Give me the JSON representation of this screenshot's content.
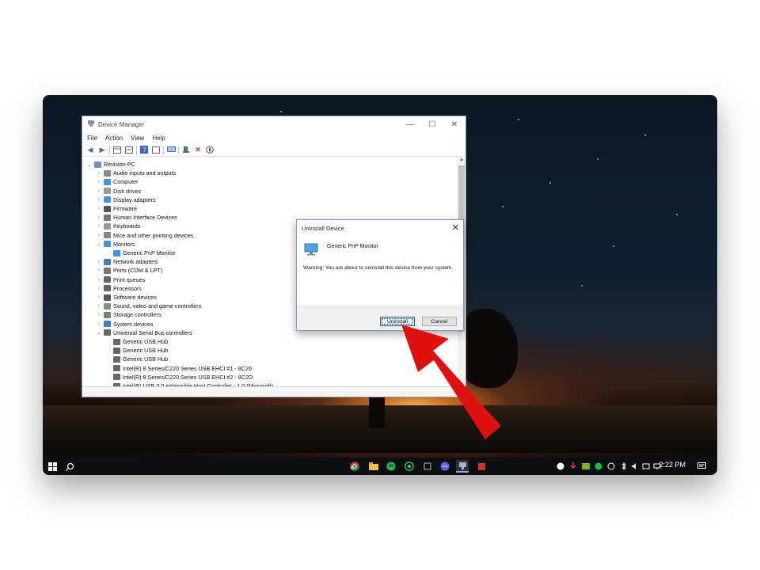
{
  "window": {
    "title": "Device Manager",
    "menu": [
      "File",
      "Action",
      "View",
      "Help"
    ],
    "controls": {
      "minimize": "—",
      "maximize": "☐",
      "close": "✕"
    }
  },
  "tree": [
    {
      "label": "Revision-PC",
      "level": 0,
      "expanded": true,
      "icon": "computer-icon"
    },
    {
      "label": "Audio inputs and outputs",
      "level": 1,
      "icon": "speaker-icon"
    },
    {
      "label": "Computer",
      "level": 1,
      "icon": "monitor-icon"
    },
    {
      "label": "Disk drives",
      "level": 1,
      "icon": "disk-icon"
    },
    {
      "label": "Display adapters",
      "level": 1,
      "icon": "display-icon"
    },
    {
      "label": "Firmware",
      "level": 1,
      "icon": "chip-icon"
    },
    {
      "label": "Human Interface Devices",
      "level": 1,
      "icon": "hid-icon"
    },
    {
      "label": "Keyboards",
      "level": 1,
      "icon": "keyboard-icon"
    },
    {
      "label": "Mice and other pointing devices",
      "level": 1,
      "icon": "mouse-icon"
    },
    {
      "label": "Monitors",
      "level": 1,
      "expanded": true,
      "icon": "monitor-icon"
    },
    {
      "label": "Generic PnP Monitor",
      "level": 2,
      "icon": "monitor-icon"
    },
    {
      "label": "Network adapters",
      "level": 1,
      "icon": "network-icon"
    },
    {
      "label": "Ports (COM & LPT)",
      "level": 1,
      "icon": "port-icon"
    },
    {
      "label": "Print queues",
      "level": 1,
      "icon": "printer-icon"
    },
    {
      "label": "Processors",
      "level": 1,
      "icon": "cpu-icon"
    },
    {
      "label": "Software devices",
      "level": 1,
      "icon": "software-icon"
    },
    {
      "label": "Sound, video and game controllers",
      "level": 1,
      "icon": "speaker-icon"
    },
    {
      "label": "Storage controllers",
      "level": 1,
      "icon": "storage-icon"
    },
    {
      "label": "System devices",
      "level": 1,
      "icon": "folder-icon"
    },
    {
      "label": "Universal Serial Bus controllers",
      "level": 1,
      "expanded": true,
      "icon": "usb-icon"
    },
    {
      "label": "Generic USB Hub",
      "level": 2,
      "icon": "usb-icon"
    },
    {
      "label": "Generic USB Hub",
      "level": 2,
      "icon": "usb-icon"
    },
    {
      "label": "Generic USB Hub",
      "level": 2,
      "icon": "usb-icon"
    },
    {
      "label": "Intel(R) 8 Series/C220 Series USB EHCI #1 - 8C26",
      "level": 2,
      "icon": "usb-icon"
    },
    {
      "label": "Intel(R) 8 Series/C220 Series USB EHCI #2 - 8C2D",
      "level": 2,
      "icon": "usb-icon"
    },
    {
      "label": "Intel(R) USB 3.0 eXtensible Host Controller - 1.0 (Microsoft)",
      "level": 2,
      "icon": "usb-icon"
    }
  ],
  "dialog": {
    "title": "Uninstall Device",
    "device": "Generic PnP Monitor",
    "warning": "Warning: You are about to uninstall this device from your system.",
    "uninstall_label": "Uninstall",
    "cancel_label": "Cancel"
  },
  "taskbar": {
    "clock": "2:22 PM"
  }
}
